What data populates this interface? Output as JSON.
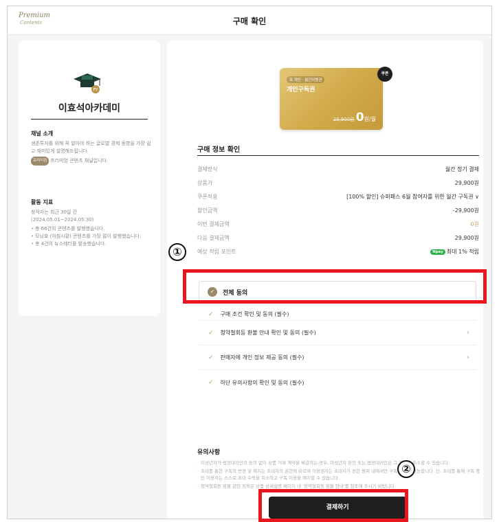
{
  "header": {
    "logo_line1": "Premium",
    "logo_line2": "Contents",
    "title": "구매 확인"
  },
  "channel": {
    "name": "이효석아카데미",
    "intro_heading": "채널 소개",
    "intro_text": "생존투자를 위해 꼭 알아야 하는 글로벌 경제 동향을 가장 쉽고 재미있게 설명해드립니다.",
    "premium_badge": "프리미엄",
    "premium_text": "프리미엄 콘텐츠 채널입니다.",
    "activity_heading": "활동 지표",
    "activity_period": "창작자는 최근 30일 간",
    "activity_dates": "(2024.05.01~2024.05.30)",
    "activity_items": [
      "총 66건의 콘텐츠를 발행했습니다.",
      "모닝효 (아침시황) 콘텐츠를 가장 많이 발행했습니다.",
      "총 4건의 뉴스레터를 발송했습니다."
    ]
  },
  "ticket": {
    "tag": "유 개인 · 월간이용권",
    "name": "개인구독권",
    "original_price": "29,900원",
    "price": "0",
    "unit": "원/월",
    "coupon_badge": "쿠폰"
  },
  "info": {
    "title": "구매 정보 확인",
    "rows": [
      {
        "label": "결제방식",
        "value": "월간 정기 결제"
      },
      {
        "label": "상품가",
        "value": "29,900원"
      },
      {
        "label": "쿠폰적용",
        "value": "[100% 할인] 슈퍼패스 6월 참여자를 위한 월간 구독권 ∨"
      },
      {
        "label": "할인금액",
        "value": "-29,900원"
      },
      {
        "label": "이번 결제금액",
        "value": "0원"
      },
      {
        "label": "다음 결제금액",
        "value": "29,900원"
      },
      {
        "label": "예상 적립 포인트",
        "value": "최대 1% 적립",
        "badge": "Npay"
      }
    ]
  },
  "agreement": {
    "all_label": "전체 동의",
    "items": [
      "구매 조건 확인 및 동의 (필수)",
      "청약철회등 환불 안내 확인 및 동의 (필수)",
      "판매자에 개인 정보 제공 동의 (필수)",
      "하단 유의사항의 확인 및 동의 (필수)"
    ]
  },
  "notice": {
    "title": "유의사항",
    "items": [
      "미성년자가 법정대리인의 동의 없이 상품 거래 계약을 체결하는 경우, 미성년자 본인 또는 법정대리인은 그 계약을 취소할 수 있습니다.",
      "초대를 통한 구독의 변경 및 해지는 초대자의 권한에 따르며 이용권자는 초대자가 정한 범위 내에서만 구독 이용이 가능합니다. 단, 초대를 통해 구독 중인 이용자는 스스로 초대 수락을 취소하고 구독 이용을 해지할 수 있습니다.",
      "청약철회등 환불 관련 정책은 상품 상세설명 페이지 내 '청약철회등 환불 안내'를 참조해 주시기 바랍니다."
    ]
  },
  "pay_button": "결제하기",
  "annotations": {
    "step1": "①",
    "step2": "②",
    "highlight_color": "#e8171e"
  }
}
